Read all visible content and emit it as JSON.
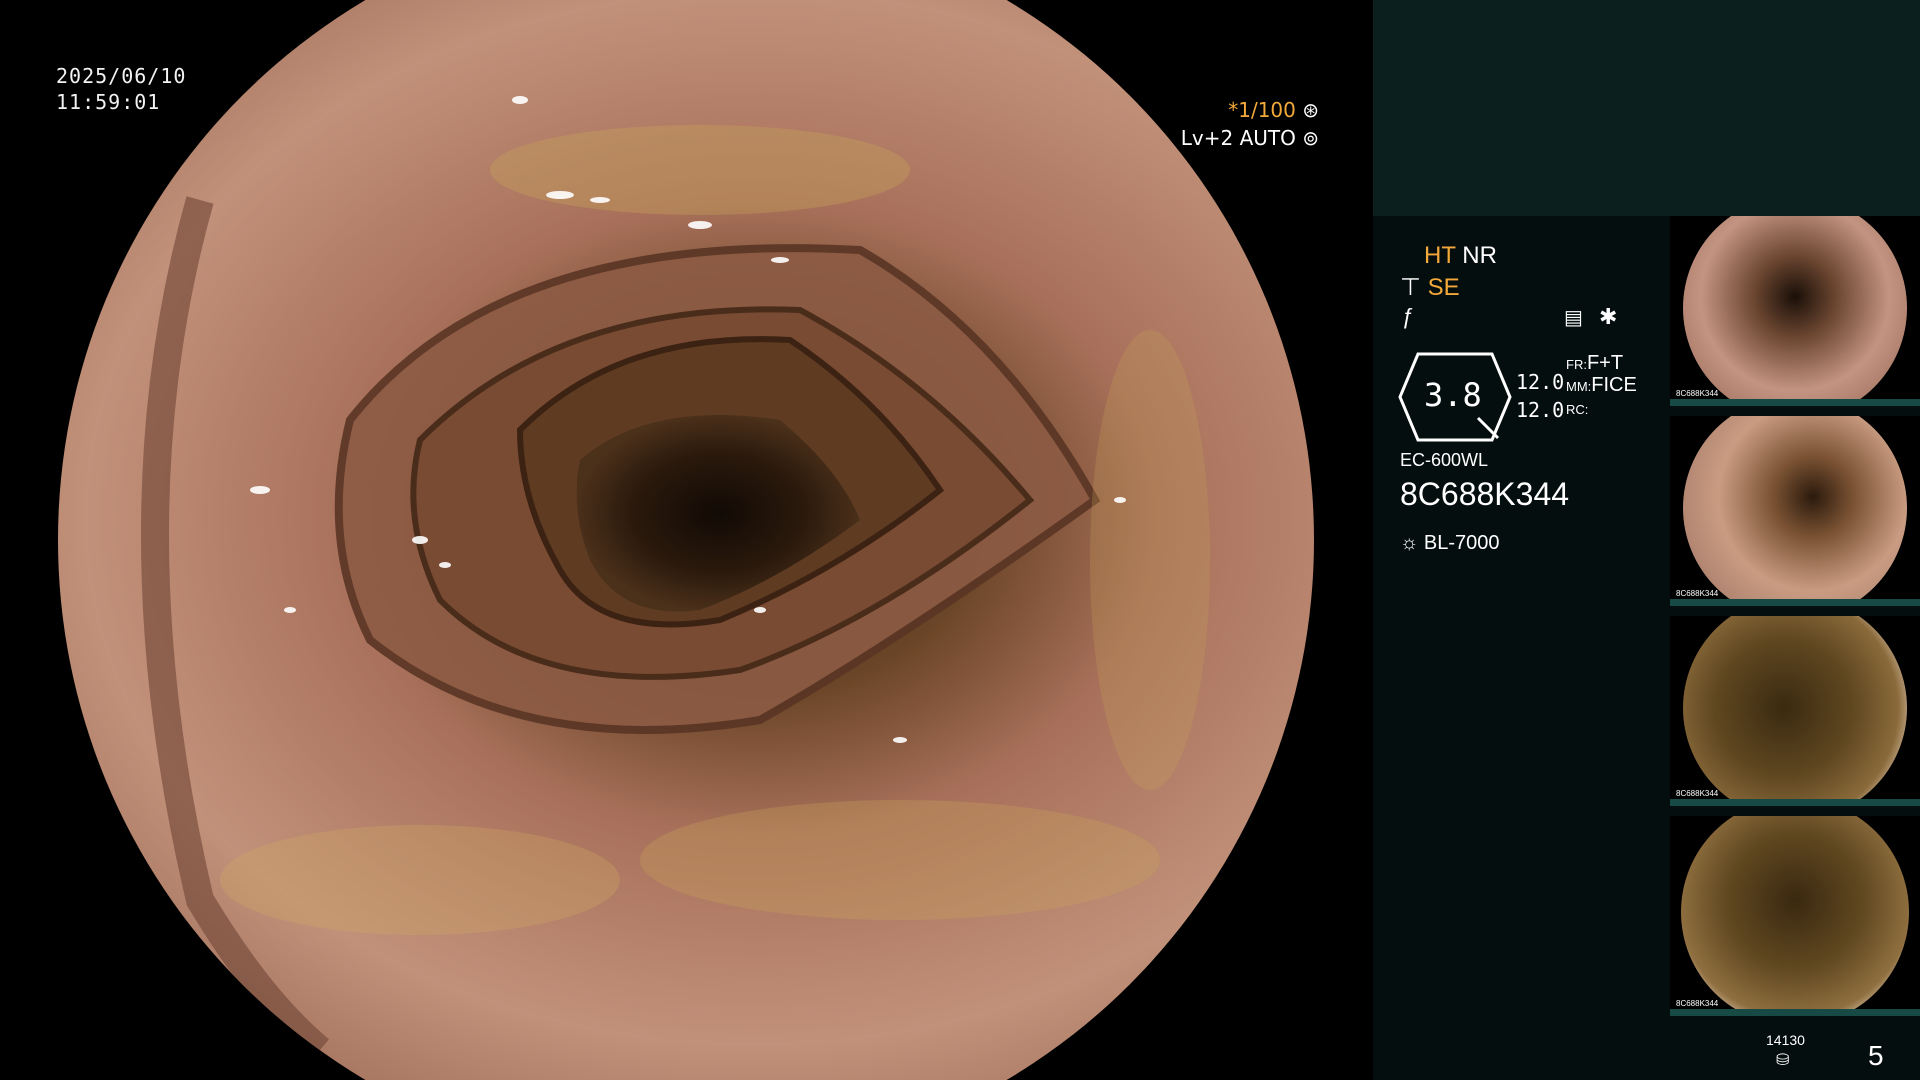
{
  "scope_view": {
    "date": "2025/06/10",
    "time": "11:59:01",
    "shutter": "*1/100",
    "shutter_icon": "aperture-icon",
    "iris": "Lv+2 AUTO",
    "iris_icon": "iris-icon"
  },
  "panel": {
    "enhance": {
      "ht": "HT",
      "nr": "NR",
      "se": "SE"
    },
    "icons": [
      "structure-enhance-icon",
      "color-tone-icon",
      "settings-list-icon",
      "asterisk-icon"
    ],
    "dial_value": "3.8",
    "gain_top": "12.0",
    "gain_bottom": "12.0",
    "fr_label": "FR:",
    "fr_value": "F+T",
    "mm_label": "MM:",
    "mm_value": "FICE",
    "rc_label": "RC:",
    "rc_value": "",
    "scope_model": "EC-600WL",
    "serial": "8C688K344",
    "light_source": "BL-7000",
    "light_icon": "light-source-icon",
    "storage_count": "14130",
    "storage_icon": "disk-icon",
    "capture_count": "5"
  },
  "thumbnails": [
    {
      "label": "8C688K344"
    },
    {
      "label": "8C688K344"
    },
    {
      "label": "8C688K344"
    },
    {
      "label": "8C688K344"
    }
  ],
  "colors": {
    "accent_orange": "#f3a83a",
    "panel_top": "#0b1f1f",
    "panel_bottom": "#050e0e",
    "thumb_bar": "#174a45"
  }
}
